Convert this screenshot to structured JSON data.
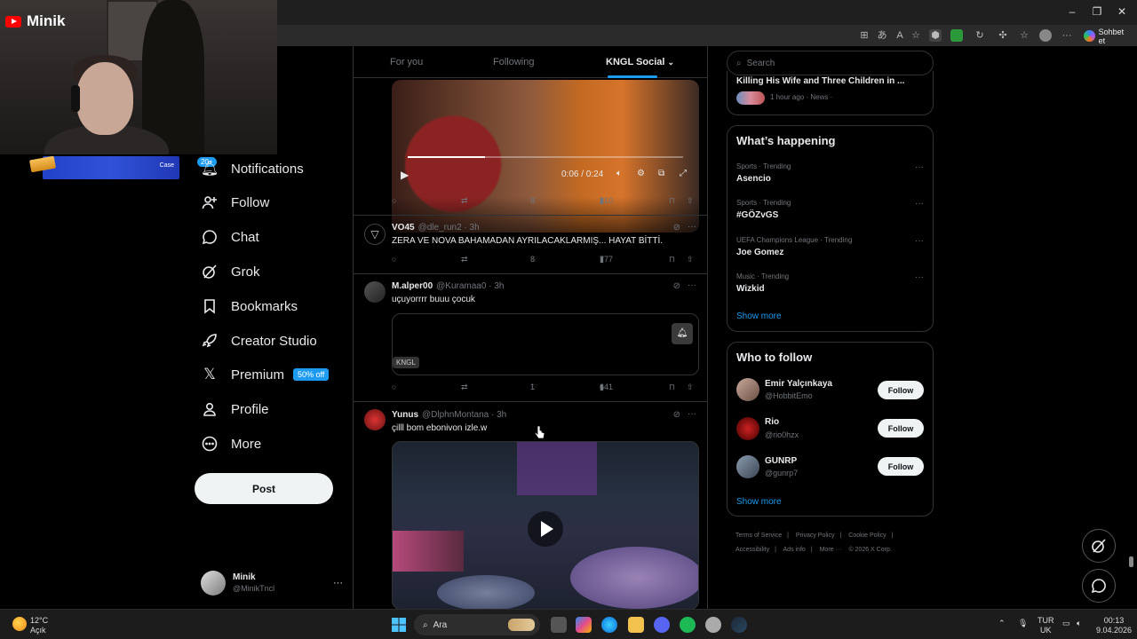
{
  "browser": {
    "copilot_label": "Sohbet et",
    "window_controls": [
      "–",
      "❐",
      "✕"
    ]
  },
  "stream": {
    "channel_name": "Minik",
    "banner_text": "Case"
  },
  "nav": {
    "notif_count": "20+",
    "items": [
      {
        "label": "Notifications",
        "icon": "bell-icon"
      },
      {
        "label": "Follow",
        "icon": "person-add-icon"
      },
      {
        "label": "Chat",
        "icon": "chat-icon"
      },
      {
        "label": "Grok",
        "icon": "grok-icon"
      },
      {
        "label": "Bookmarks",
        "icon": "bookmark-icon"
      },
      {
        "label": "Creator Studio",
        "icon": "rocket-icon"
      },
      {
        "label": "Premium",
        "icon": "x-logo-icon"
      },
      {
        "label": "Profile",
        "icon": "person-icon"
      },
      {
        "label": "More",
        "icon": "more-circle-icon"
      }
    ],
    "premium_badge": "50% off",
    "post_label": "Post",
    "account_name": "Minik",
    "account_handle": "@MinikTncl"
  },
  "feed": {
    "tabs": [
      "For you",
      "Following",
      "KNGL Social"
    ],
    "video1": {
      "time": "0:06 / 0:24",
      "progress": 0.28,
      "replies": "",
      "likes": "8",
      "views": "810"
    },
    "tweets": [
      {
        "name": "VO45",
        "handle": "@dle_run2 · 3h",
        "text": "ZERA VE NOVA BAHAMADAN AYRILACAKLARMIŞ... HAYAT BİTTİ.",
        "likes": "8",
        "views": "777"
      },
      {
        "name": "M.alper00",
        "handle": "@Kuramaa0 · 3h",
        "text": "uçuyorrrr buuu çocuk",
        "card_tag": "KNGL",
        "likes": "1",
        "views": "641"
      },
      {
        "name": "Yunus",
        "handle": "@DlphnMontana · 3h",
        "text": "çilll bom ebonivon izle.w"
      }
    ]
  },
  "sidebar": {
    "search_placeholder": "Search",
    "news_headline": "Killing His Wife and Three Children in ...",
    "news_meta": "1 hour ago · News ·",
    "happening_title": "What’s happening",
    "trends": [
      {
        "category": "Sports · Trending",
        "name": "Asencio"
      },
      {
        "category": "Sports · Trending",
        "name": "#GÖZvGS"
      },
      {
        "category": "UEFA Champions League · Trending",
        "name": "Joe Gomez"
      },
      {
        "category": "Music · Trending",
        "name": "Wizkid"
      }
    ],
    "show_more": "Show more",
    "wtf_title": "Who to follow",
    "who_to_follow": [
      {
        "name": "Emir Yalçınkaya",
        "handle": "@HobbitEmo",
        "button": "Follow"
      },
      {
        "name": "Rio",
        "handle": "@rio0hzx",
        "button": "Follow"
      },
      {
        "name": "GUNRP",
        "handle": "@gunrp7",
        "button": "Follow"
      }
    ],
    "footer_links": [
      "Terms of Service",
      "|",
      "Privacy Policy",
      "|",
      "Cookie Policy",
      "|",
      "Accessibility",
      "|",
      "Ads info",
      "|",
      "More ···",
      "© 2026 X Corp."
    ]
  },
  "taskbar": {
    "weather_temp": "12°C",
    "weather_desc": "Açık",
    "search_label": "Ara",
    "lang": "TUR",
    "lang_sub": "UK",
    "time": "00:13",
    "date": "9.04.2026"
  },
  "colors": {
    "accent": "#1d9bf0",
    "background": "#000000",
    "border": "#2f3336"
  }
}
